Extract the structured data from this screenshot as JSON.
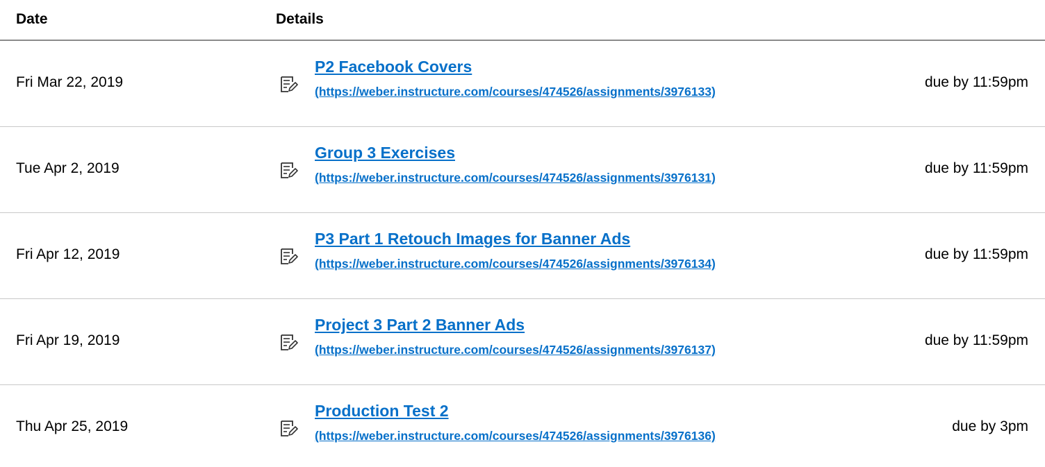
{
  "header": {
    "date_label": "Date",
    "details_label": "Details"
  },
  "colors": {
    "link": "#0770c9",
    "divider": "#c8c8c8",
    "header_divider": "#8a8a8a"
  },
  "rows": [
    {
      "date": "Fri Mar 22, 2019",
      "icon": "assignment-icon",
      "title": "P2 Facebook Covers",
      "url": "(https://weber.instructure.com/courses/474526/assignments/3976133)",
      "due": "due by 11:59pm"
    },
    {
      "date": "Tue Apr 2, 2019",
      "icon": "assignment-icon",
      "title": "Group 3 Exercises",
      "url": "(https://weber.instructure.com/courses/474526/assignments/3976131)",
      "due": "due by 11:59pm"
    },
    {
      "date": "Fri Apr 12, 2019",
      "icon": "assignment-icon",
      "title": "P3 Part 1 Retouch Images for Banner Ads",
      "url": "(https://weber.instructure.com/courses/474526/assignments/3976134)",
      "due": "due by 11:59pm"
    },
    {
      "date": "Fri Apr 19, 2019",
      "icon": "assignment-icon",
      "title": "Project 3 Part 2 Banner Ads",
      "url": "(https://weber.instructure.com/courses/474526/assignments/3976137)",
      "due": "due by 11:59pm"
    },
    {
      "date": "Thu Apr 25, 2019",
      "icon": "assignment-icon",
      "title": "Production Test 2",
      "url": "(https://weber.instructure.com/courses/474526/assignments/3976136)",
      "due": "due by 3pm"
    }
  ]
}
